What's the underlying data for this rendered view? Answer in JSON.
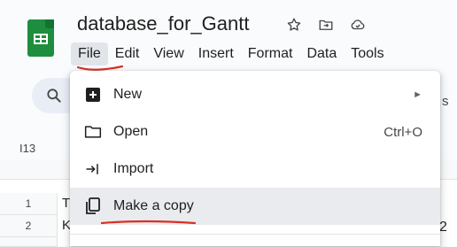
{
  "app": {
    "title": "database_for_Gantt"
  },
  "title_icons": [
    "star-icon",
    "move-to-folder-icon",
    "cloud-status-icon"
  ],
  "menubar": {
    "items": [
      "File",
      "Edit",
      "View",
      "Insert",
      "Format",
      "Data",
      "Tools"
    ],
    "active": "File"
  },
  "namebox": {
    "value": "I13"
  },
  "sheet": {
    "rows": [
      {
        "number": "1",
        "cell_fragment": "T"
      },
      {
        "number": "2",
        "cell_fragment": "K"
      }
    ],
    "right_fragment": "2"
  },
  "file_menu": {
    "items": [
      {
        "label": "New",
        "icon": "new-sheet-icon",
        "submenu": true
      },
      {
        "label": "Open",
        "icon": "folder-icon",
        "shortcut": "Ctrl+O"
      },
      {
        "label": "Import",
        "icon": "import-icon"
      },
      {
        "label": "Make a copy",
        "icon": "copy-icon",
        "highlighted": true
      }
    ],
    "submenu_arrow": "►",
    "partial_right_text": "s"
  },
  "annotation_color": "#d93025"
}
